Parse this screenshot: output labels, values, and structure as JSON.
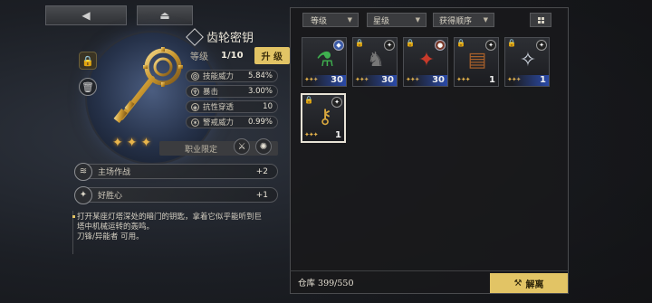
{
  "nav": {
    "back_icon": "◀",
    "home_icon": "⏏"
  },
  "item": {
    "title": "齿轮密钥",
    "level_label": "等级",
    "level_value": "1/10",
    "upgrade_label": "升 级",
    "rarity_stars": 3
  },
  "stats": [
    {
      "name": "技能威力",
      "value": "5.84%",
      "icon": "gear-icon"
    },
    {
      "name": "暴击",
      "value": "3.00%",
      "icon": "trophy-icon"
    },
    {
      "name": "抗性穿透",
      "value": "10",
      "icon": "shield-icon"
    },
    {
      "name": "警戒威力",
      "value": "0.99%",
      "icon": "star-icon"
    }
  ],
  "job": {
    "label": "职业限定"
  },
  "skills": [
    {
      "name": "主场作战",
      "value": "+2"
    },
    {
      "name": "好胜心",
      "value": "+1"
    }
  ],
  "description": {
    "line1": "打开某座灯塔深处的暗门的钥匙，拿着它似乎能听到巨",
    "line2": "塔中机械运转的轰鸣。",
    "line3": "刀锋/异能者 可用。"
  },
  "filters": {
    "level": "等级",
    "stars": "星级",
    "order": "获得顺序"
  },
  "inventory": [
    {
      "name": "green-potion",
      "count": "30",
      "badge": "blue",
      "locked": false,
      "glyph": "⚗",
      "stars": 3
    },
    {
      "name": "dark-cat",
      "count": "30",
      "badge": "dark",
      "locked": true,
      "glyph": "🐈",
      "stars": 3
    },
    {
      "name": "red-scepter",
      "count": "30",
      "badge": "red",
      "locked": true,
      "glyph": "✦",
      "stars": 3
    },
    {
      "name": "brown-book",
      "count": "1",
      "badge": "dark",
      "locked": true,
      "glyph": "📕",
      "stars": 3
    },
    {
      "name": "silver-key",
      "count": "1",
      "badge": "dark",
      "locked": true,
      "glyph": "✧",
      "stars": 3
    },
    {
      "name": "gear-key",
      "count": "1",
      "badge": "dark",
      "locked": true,
      "glyph": "🗝",
      "stars": 3
    }
  ],
  "footer": {
    "storage": "仓库 399/550",
    "dismantle_label": "解离"
  }
}
